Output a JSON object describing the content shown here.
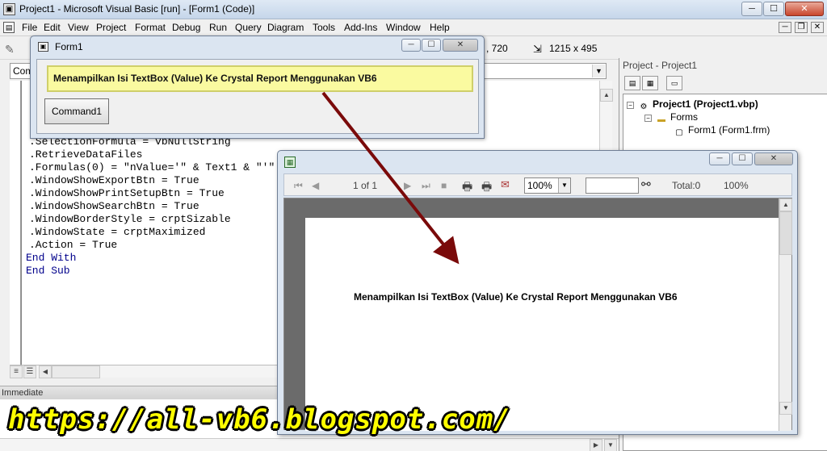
{
  "window": {
    "title": "Project1 - Microsoft Visual Basic [run] - [Form1 (Code)]",
    "minimize": "─",
    "maximize": "☐",
    "close": "✕"
  },
  "menubar": {
    "items": [
      "File",
      "Edit",
      "View",
      "Project",
      "Format",
      "Debug",
      "Run",
      "Query",
      "Diagram",
      "Tools",
      "Add-Ins",
      "Window",
      "Help"
    ]
  },
  "toolbar": {
    "position_readout": ", 720",
    "size_readout": "1215 x 495"
  },
  "code_editor": {
    "object_combo": "Com",
    "lines": [
      ".SelectionFormula = vbNullString",
      ".RetrieveDataFiles",
      ".Formulas(0) = \"nValue='\" & Text1 & \"'\"",
      ".WindowShowExportBtn = True",
      ".WindowShowPrintSetupBtn = True",
      ".WindowShowSearchBtn = True",
      ".WindowBorderStyle = crptSizable",
      ".WindowState = crptMaximized",
      ".Action = True",
      "End With",
      "End Sub"
    ]
  },
  "immediate": {
    "title": "Immediate"
  },
  "project_explorer": {
    "title": "Project - Project1",
    "project_node": "Project1 (Project1.vbp)",
    "forms_node": "Forms",
    "form_node": "Form1 (Form1.frm)"
  },
  "form1": {
    "title": "Form1",
    "textbox_value": "Menampilkan Isi TextBox (Value) Ke Crystal Report Menggunakan VB6",
    "command_label": "Command1"
  },
  "report_viewer": {
    "page_indicator": "1 of 1",
    "zoom": "100%",
    "total_label": "Total:0",
    "percent_label": "100%",
    "report_text": "Menampilkan Isi TextBox (Value) Ke Crystal Report Menggunakan VB6"
  },
  "watermark": {
    "text": "https://all-vb6.blogspot.com/"
  }
}
